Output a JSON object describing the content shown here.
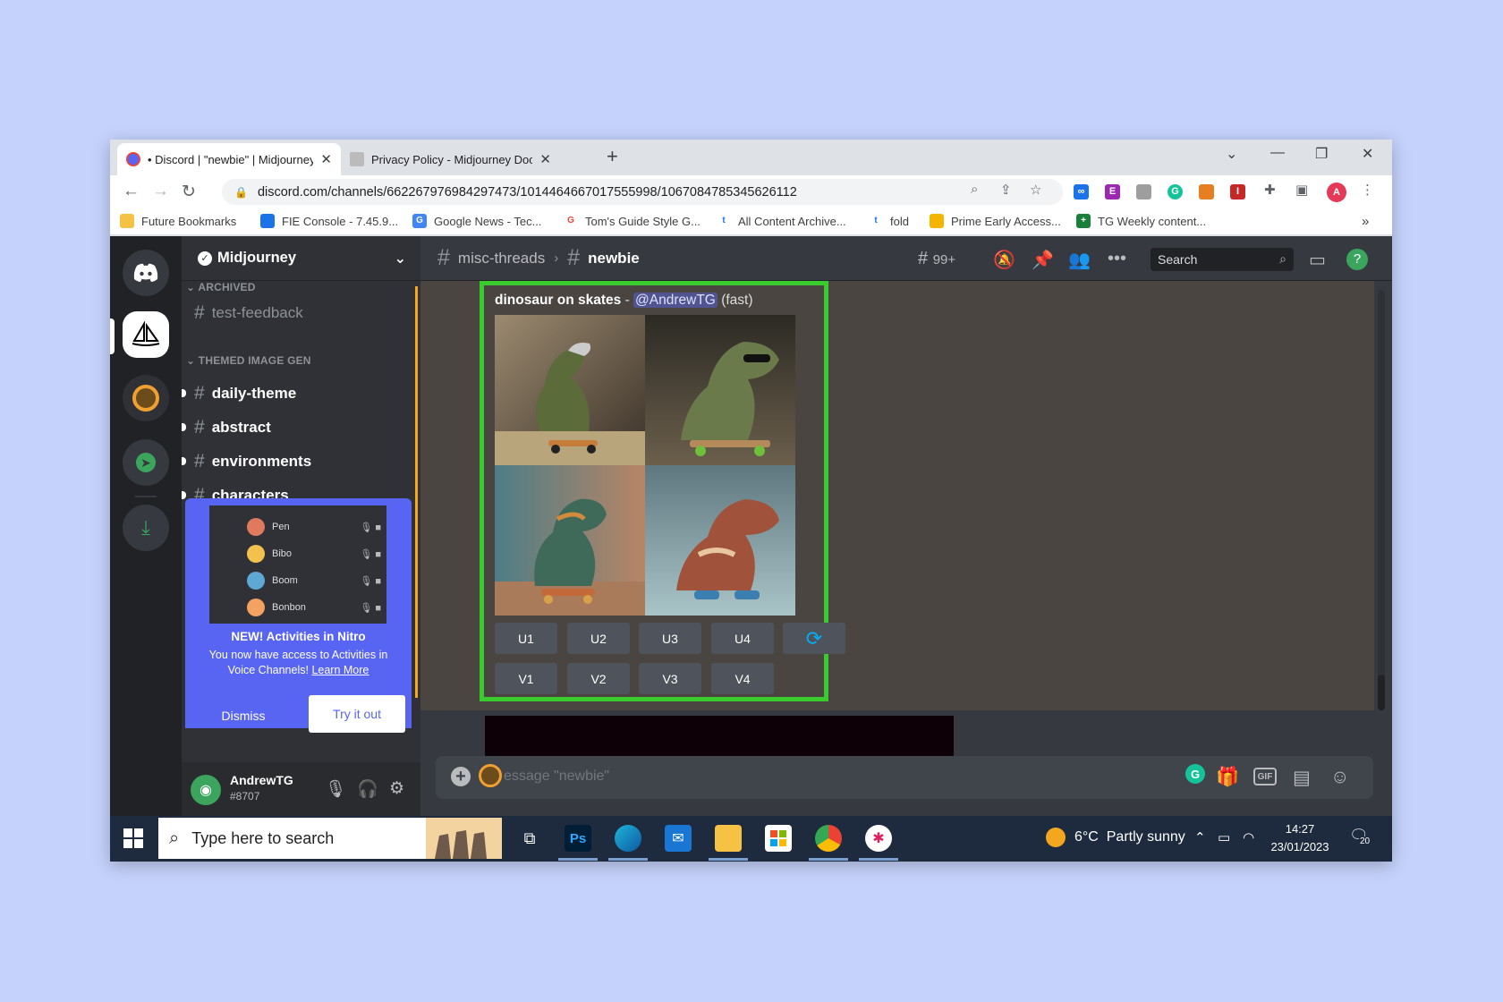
{
  "browser": {
    "tabs": [
      {
        "label": "• Discord | \"newbie\" | Midjourney"
      },
      {
        "label": "Privacy Policy - Midjourney Docu"
      }
    ],
    "url": "discord.com/channels/662267976984297473/1014464667017555998/1067084785345626112",
    "bookmarks": [
      {
        "label": "Future Bookmarks"
      },
      {
        "label": "FIE Console - 7.45.9..."
      },
      {
        "label": "Google News - Tec..."
      },
      {
        "label": "Tom's Guide Style G..."
      },
      {
        "label": "All Content Archive..."
      },
      {
        "label": "fold"
      },
      {
        "label": "Prime Early Access..."
      },
      {
        "label": "TG Weekly content..."
      }
    ]
  },
  "server": {
    "name": "Midjourney",
    "categories": [
      {
        "label": "ARCHIVED"
      },
      {
        "label": "THEMED IMAGE GEN"
      }
    ],
    "channels": [
      {
        "label": "test-feedback"
      },
      {
        "label": "daily-theme"
      },
      {
        "label": "abstract"
      },
      {
        "label": "environments"
      },
      {
        "label": "characters"
      }
    ]
  },
  "nitro": {
    "voice_users": [
      "Pen",
      "Bibo",
      "Boom",
      "Bonbon"
    ],
    "title": "NEW! Activities in Nitro",
    "desc": "You now have access to Activities in Voice Channels!",
    "learn_more": "Learn More",
    "dismiss": "Dismiss",
    "try_it_out": "Try it out"
  },
  "user": {
    "name": "AndrewTG",
    "tag": "#8707"
  },
  "header": {
    "parent_channel": "misc-threads",
    "current_channel": "newbie",
    "threads_count": "99+",
    "search_placeholder": "Search"
  },
  "message": {
    "prompt": "dinosaur on skates",
    "separator": " - ",
    "mention": "@AndrewTG",
    "speed": "(fast)",
    "upscale_buttons": [
      "U1",
      "U2",
      "U3",
      "U4"
    ],
    "variation_buttons": [
      "V1",
      "V2",
      "V3",
      "V4"
    ]
  },
  "input": {
    "placeholder": "essage \"newbie\"",
    "gif": "GIF"
  },
  "taskbar": {
    "search_placeholder": "Type here to search",
    "apps": [
      "Ps"
    ],
    "weather_temp": "6°C",
    "weather_desc": "Partly sunny",
    "time": "14:27",
    "date": "23/01/2023",
    "notifications": "20"
  },
  "colors": {
    "discord_blurple": "#5865f2",
    "highlight_green": "#3acb2f",
    "thread_orange": "#faa61a"
  }
}
